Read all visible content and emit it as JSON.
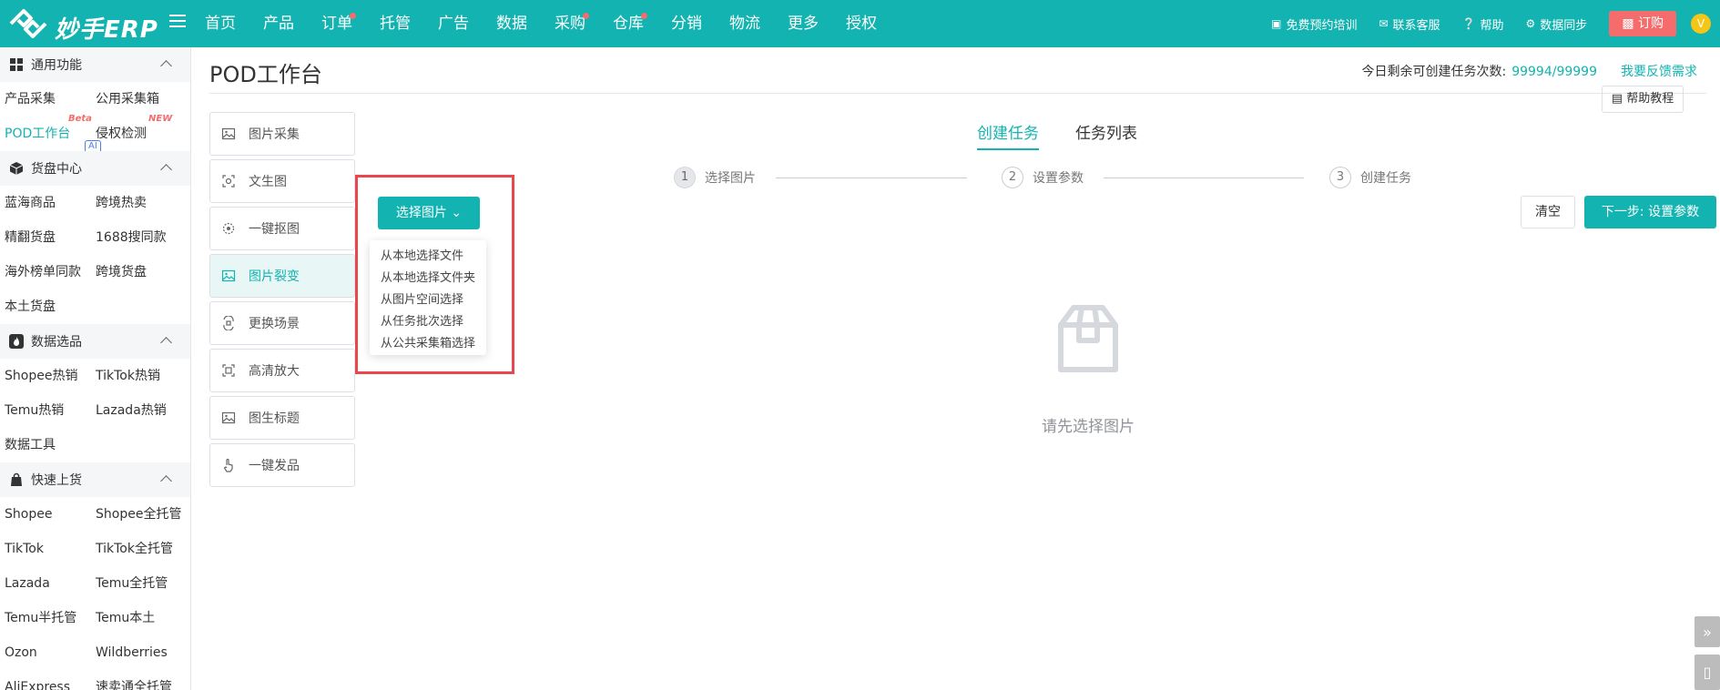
{
  "app": {
    "logo_text": "妙手ERP"
  },
  "nav": [
    {
      "label": "首页",
      "dot": false
    },
    {
      "label": "产品",
      "dot": false
    },
    {
      "label": "订单",
      "dot": true
    },
    {
      "label": "托管",
      "dot": false
    },
    {
      "label": "广告",
      "dot": false
    },
    {
      "label": "数据",
      "dot": false
    },
    {
      "label": "采购",
      "dot": true
    },
    {
      "label": "仓库",
      "dot": true
    },
    {
      "label": "分销",
      "dot": false
    },
    {
      "label": "物流",
      "dot": false
    },
    {
      "label": "更多",
      "dot": false
    },
    {
      "label": "授权",
      "dot": false
    }
  ],
  "top_right": {
    "training": "免费预约培训",
    "support": "联系客服",
    "help": "帮助",
    "sync": "数据同步",
    "order": "订购",
    "avatar": "V"
  },
  "sidebar": {
    "sections": [
      {
        "title": "通用功能",
        "items": [
          "产品采集",
          "公用采集箱",
          "POD工作台",
          "侵权检测"
        ]
      },
      {
        "title": "货盘中心",
        "items": [
          "蓝海商品",
          "跨境热卖",
          "精翻货盘",
          "1688搜同款",
          "海外榜单同款",
          "跨境货盘",
          "本土货盘"
        ]
      },
      {
        "title": "数据选品",
        "items": [
          "Shopee热销",
          "TikTok热销",
          "Temu热销",
          "Lazada热销",
          "数据工具"
        ]
      },
      {
        "title": "快速上货",
        "items": [
          "Shopee",
          "Shopee全托管",
          "TikTok",
          "TikTok全托管",
          "Lazada",
          "Temu全托管",
          "Temu半托管",
          "Temu本土",
          "Ozon",
          "Wildberries",
          "AliExpress",
          "速卖通全托管"
        ]
      }
    ],
    "badges": {
      "beta": "Beta",
      "new": "NEW",
      "ai": "AI"
    }
  },
  "page": {
    "title": "POD工作台",
    "quota_label": "今日剩余可创建任务次数:",
    "quota_value": "99994/99999",
    "feedback": "我要反馈需求",
    "help": "帮助教程"
  },
  "tools": [
    "图片采集",
    "文生图",
    "一键抠图",
    "图片裂变",
    "更换场景",
    "高清放大",
    "图生标题",
    "一键发品"
  ],
  "select": {
    "button": "选择图片",
    "options": [
      "从本地选择文件",
      "从本地选择文件夹",
      "从图片空间选择",
      "从任务批次选择",
      "从公共采集箱选择"
    ]
  },
  "tabs": [
    "创建任务",
    "任务列表"
  ],
  "steps": [
    {
      "num": "1",
      "label": "选择图片"
    },
    {
      "num": "2",
      "label": "设置参数"
    },
    {
      "num": "3",
      "label": "创建任务"
    }
  ],
  "actions": {
    "clear": "清空",
    "next": "下一步: 设置参数"
  },
  "empty": {
    "text": "请先选择图片"
  },
  "colors": {
    "primary": "#12b3b0",
    "danger": "#f56c6c",
    "highlight": "#e8474d"
  }
}
